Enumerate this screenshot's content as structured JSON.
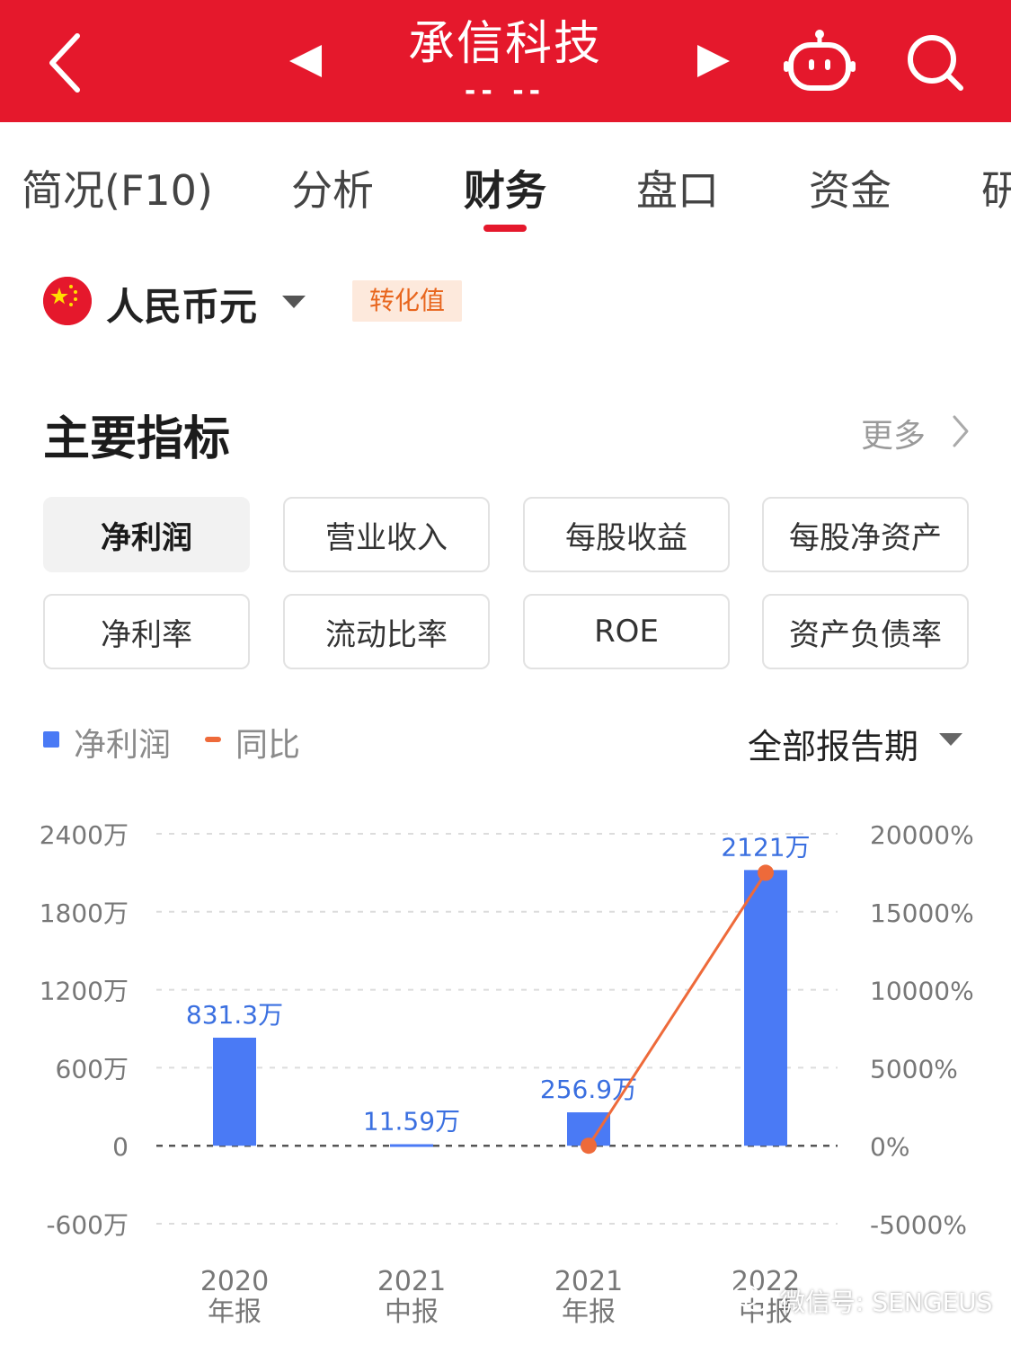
{
  "header": {
    "title": "承信科技",
    "subtitle": "-- --",
    "back_icon": "chevron-left-icon",
    "prev_icon": "triangle-left-icon",
    "next_icon": "triangle-right-icon",
    "robot_icon": "robot-icon",
    "search_icon": "search-icon",
    "color": "#e5182c"
  },
  "tabs": [
    {
      "label": "简况(F10)"
    },
    {
      "label": "分析"
    },
    {
      "label": "财务",
      "active": true
    },
    {
      "label": "盘口"
    },
    {
      "label": "资金"
    },
    {
      "label": "研"
    }
  ],
  "currency": {
    "label": "人民币元",
    "flag_icon": "china-flag-icon",
    "convert_label": "转化值"
  },
  "section": {
    "title": "主要指标",
    "more_label": "更多"
  },
  "metrics": [
    {
      "label": "净利润",
      "active": true
    },
    {
      "label": "营业收入"
    },
    {
      "label": "每股收益"
    },
    {
      "label": "每股净资产"
    },
    {
      "label": "净利率"
    },
    {
      "label": "流动比率"
    },
    {
      "label": "ROE"
    },
    {
      "label": "资产负债率"
    }
  ],
  "legend": {
    "bar_label": "净利润",
    "line_label": "同比",
    "period_label": "全部报告期"
  },
  "chart_data": {
    "type": "bar",
    "categories": [
      [
        "2020",
        "年报"
      ],
      [
        "2021",
        "中报"
      ],
      [
        "2021",
        "年报"
      ],
      [
        "2022",
        "中报"
      ]
    ],
    "series": [
      {
        "name": "净利润",
        "type": "bar",
        "axis": "left",
        "values": [
          831.3,
          11.59,
          256.9,
          2121
        ],
        "labels": [
          "831.3万",
          "11.59万",
          "256.9万",
          "2121万"
        ],
        "color": "#4a7af5"
      },
      {
        "name": "同比",
        "type": "line",
        "axis": "right",
        "values": [
          null,
          null,
          0,
          17500
        ],
        "color": "#ee6a3a"
      }
    ],
    "y_left": {
      "ticks": [
        2400,
        1800,
        1200,
        600,
        0,
        -600
      ],
      "tick_labels": [
        "2400万",
        "1800万",
        "1200万",
        "600万",
        "0",
        "-600万"
      ],
      "ylim": [
        -600,
        2400
      ]
    },
    "y_right": {
      "ticks": [
        20000,
        15000,
        10000,
        5000,
        0,
        -5000
      ],
      "tick_labels": [
        "20000%",
        "15000%",
        "10000%",
        "5000%",
        "0%",
        "-5000%"
      ],
      "ylim": [
        -5000,
        20000
      ]
    },
    "grid": true
  },
  "watermark": {
    "text": "微信号: SENGEUS"
  }
}
